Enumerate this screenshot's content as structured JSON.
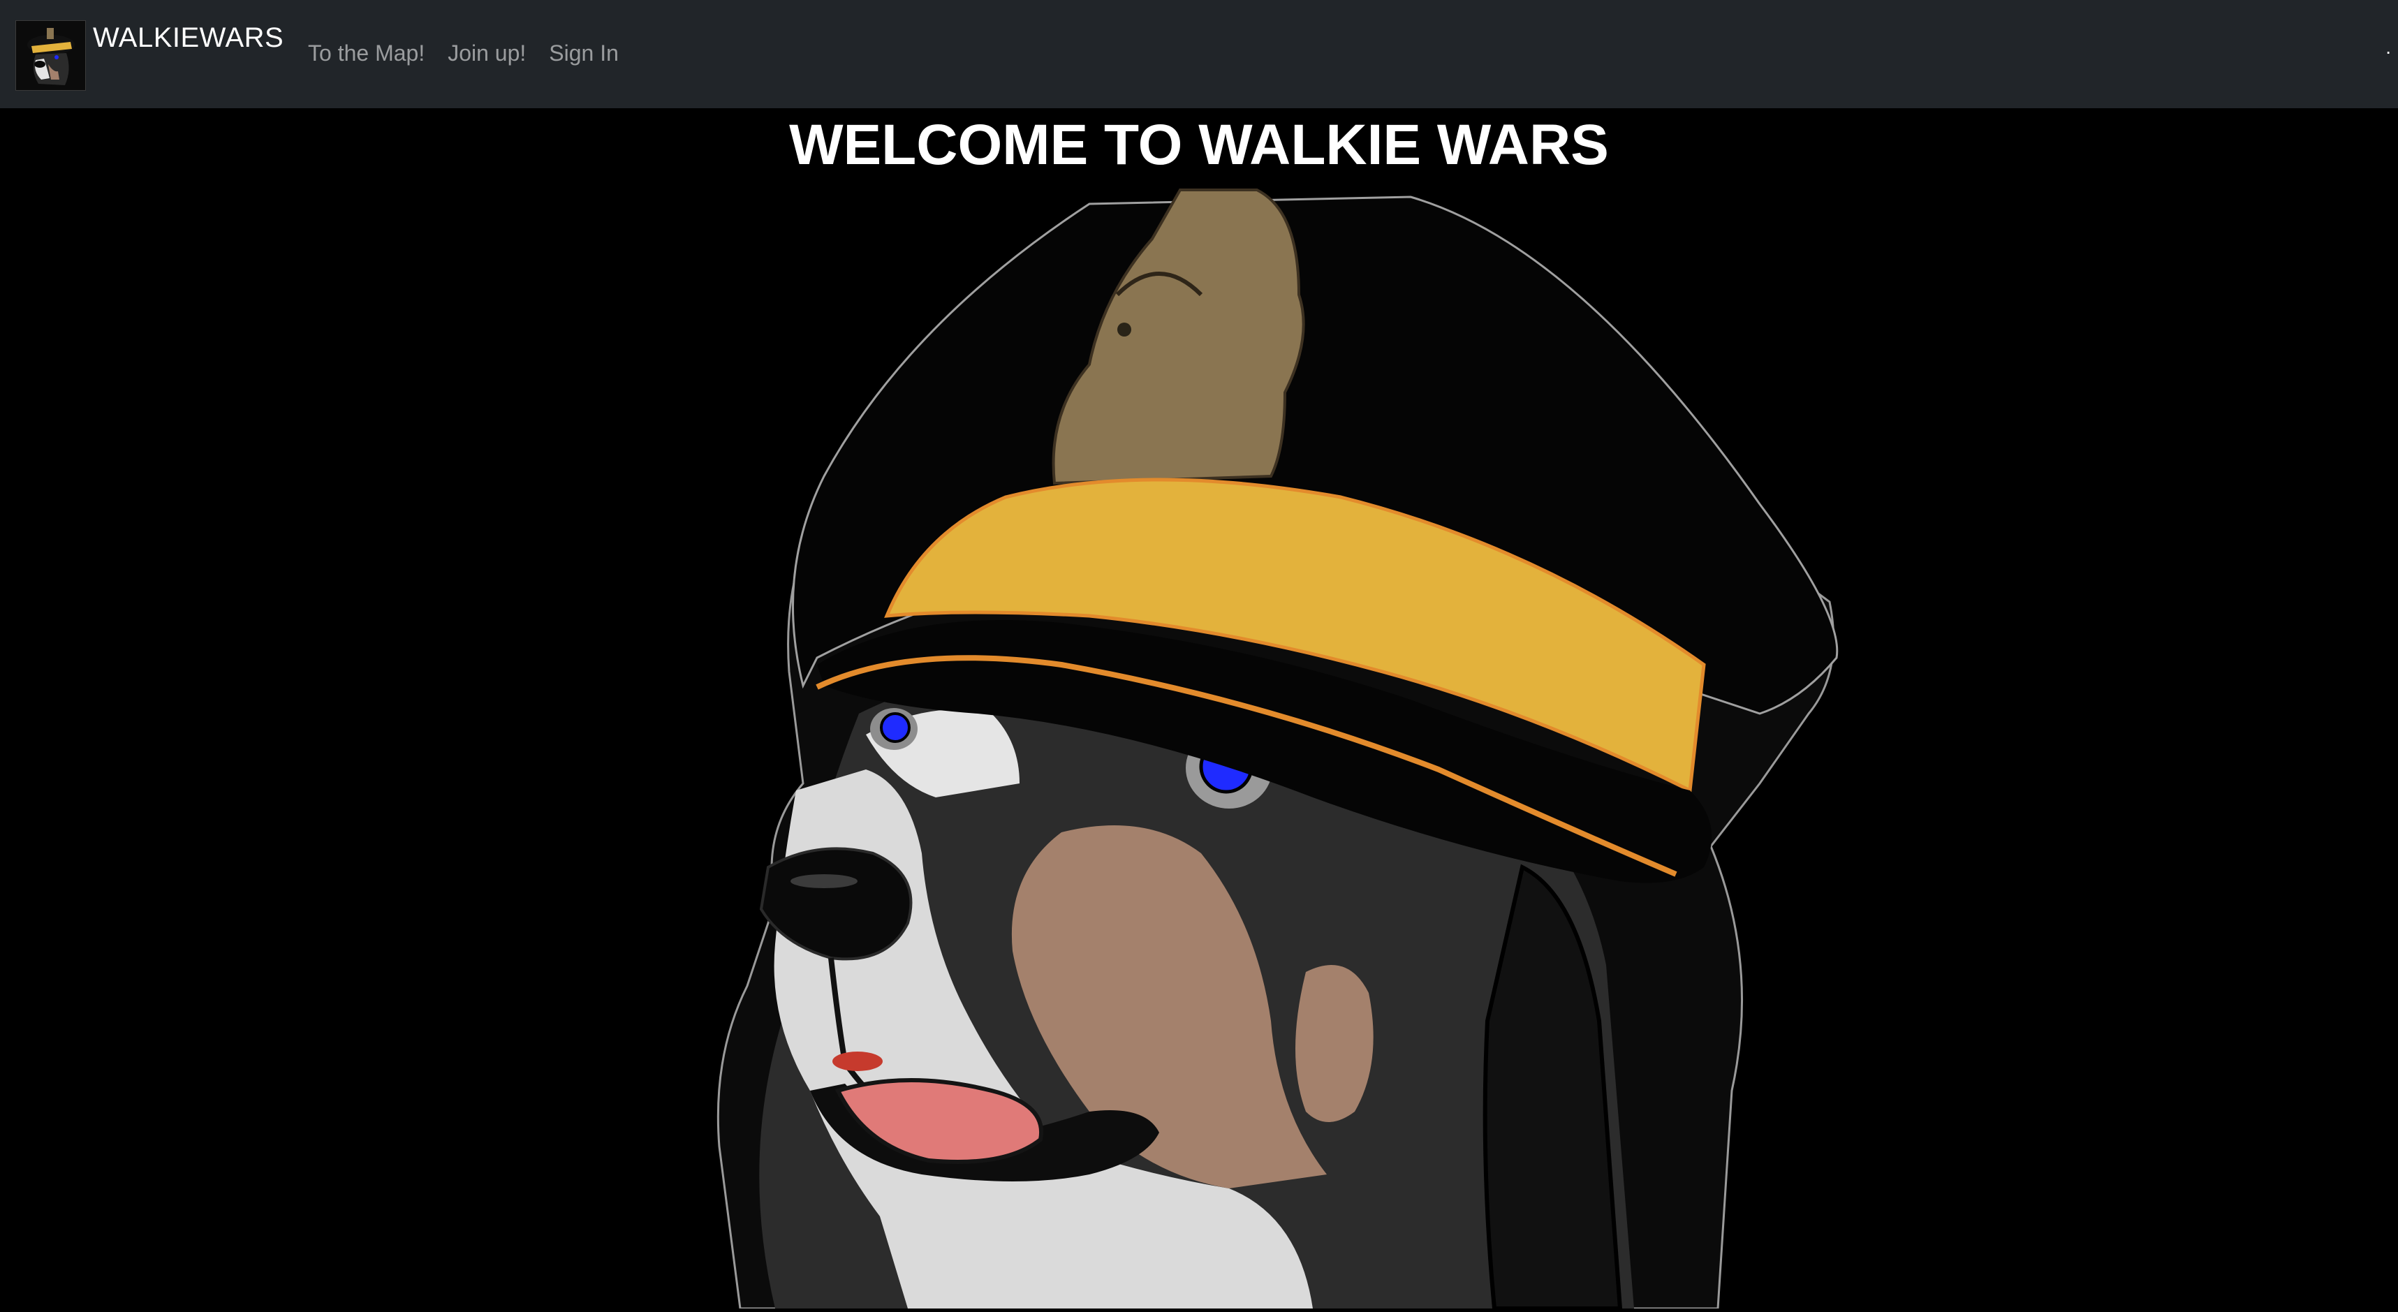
{
  "navbar": {
    "brand": "WALKIEWARS",
    "links": [
      "To the Map!",
      "Join up!",
      "Sign In"
    ],
    "trailing": "."
  },
  "hero": {
    "title": "WELCOME TO WALKIE WARS"
  },
  "colors": {
    "navbar_bg": "#212529",
    "page_bg": "#000000",
    "cap_band": "#e3b23c",
    "mascot_tan": "#a4816c",
    "eye_blue": "#1f2bff",
    "tongue": "#e07a78",
    "badge_khaki": "#8a7551"
  },
  "icons": [
    "site-logo-icon",
    "mascot-dog-illustration"
  ]
}
